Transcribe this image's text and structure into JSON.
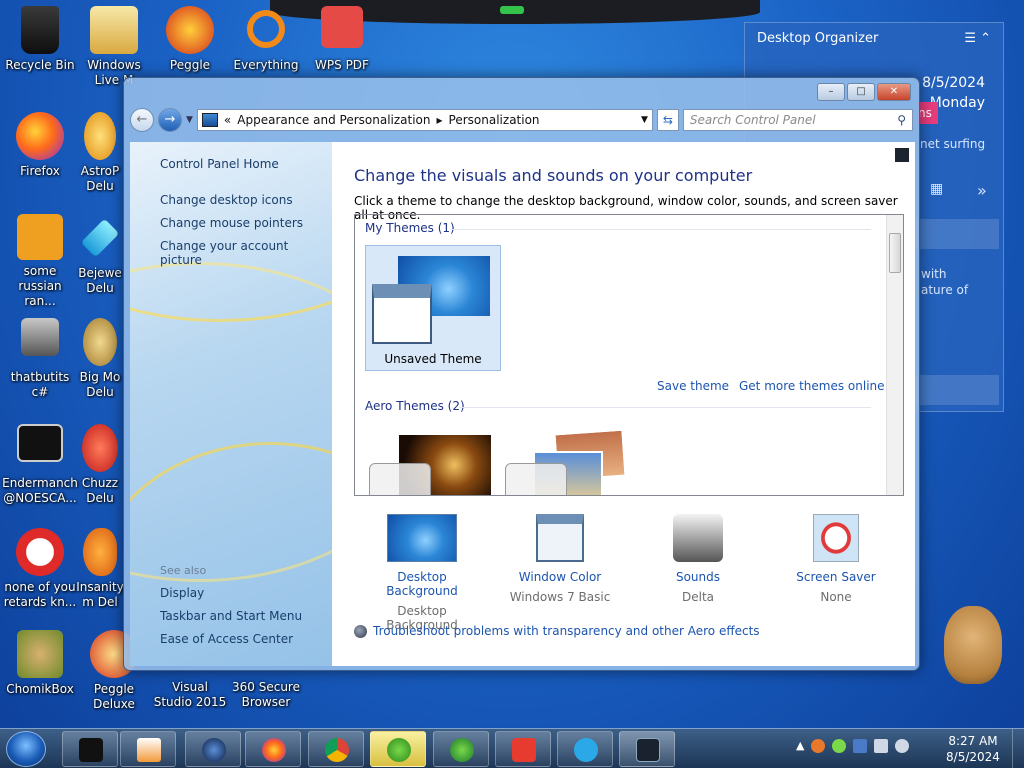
{
  "desktop": {
    "icons": [
      {
        "label": "Recycle Bin"
      },
      {
        "label": "Windows Live M"
      },
      {
        "label": "Peggle"
      },
      {
        "label": "Everything"
      },
      {
        "label": "WPS PDF"
      },
      {
        "label": "Firefox"
      },
      {
        "label": "AstroP Delu"
      },
      {
        "label": "some russian ran..."
      },
      {
        "label": "Bejewe Delu"
      },
      {
        "label": "thatbutits c#"
      },
      {
        "label": "Big Mo Delu"
      },
      {
        "label": "Endermanch @NOESCA..."
      },
      {
        "label": "Chuzz Delu"
      },
      {
        "label": "none of you retards kn..."
      },
      {
        "label": "Insanity m Del"
      },
      {
        "label": "ChomikBox"
      },
      {
        "label": "Peggle Deluxe"
      },
      {
        "label": "Visual Studio 2015"
      },
      {
        "label": "360 Secure Browser"
      }
    ]
  },
  "organizer": {
    "title": "Desktop Organizer",
    "date": "8/5/2024",
    "day": "Monday",
    "pink_badge": "ns",
    "text1": "net surfing",
    "text2": "with",
    "text3": "ature of"
  },
  "window": {
    "controls": {
      "minimize": "–",
      "maximize": "□",
      "close": "✕"
    },
    "address": {
      "sep": "«",
      "crumb1": "Appearance and Personalization",
      "crumb_arrow": "▸",
      "crumb2": "Personalization"
    },
    "search_placeholder": "Search Control Panel",
    "left": {
      "home": "Control Panel Home",
      "links": [
        "Change desktop icons",
        "Change mouse pointers",
        "Change your account picture"
      ],
      "see_also": "See also",
      "see_links": [
        "Display",
        "Taskbar and Start Menu",
        "Ease of Access Center"
      ]
    },
    "main": {
      "title": "Change the visuals and sounds on your computer",
      "subtitle": "Click a theme to change the desktop background, window color, sounds, and screen saver all at once.",
      "my_themes": "My Themes (1)",
      "unsaved_theme": "Unsaved Theme",
      "save_theme": "Save theme",
      "more_themes": "Get more themes online",
      "aero_themes": "Aero Themes (2)",
      "bottom": [
        {
          "title": "Desktop Background",
          "sub": "Desktop Background"
        },
        {
          "title": "Window Color",
          "sub": "Windows 7 Basic"
        },
        {
          "title": "Sounds",
          "sub": "Delta"
        },
        {
          "title": "Screen Saver",
          "sub": "None"
        }
      ],
      "troubleshoot": "Troubleshoot problems with transparency and other Aero effects"
    }
  },
  "taskbar": {
    "time": "8:27 AM",
    "date": "8/5/2024"
  }
}
